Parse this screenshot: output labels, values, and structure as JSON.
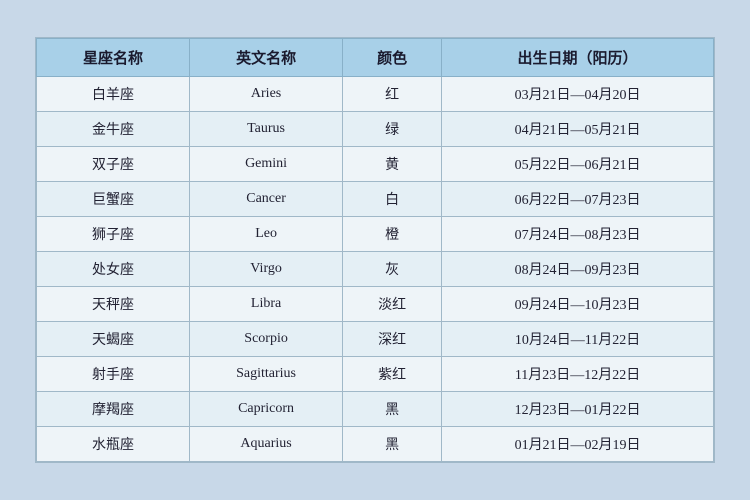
{
  "table": {
    "headers": [
      "星座名称",
      "英文名称",
      "颜色",
      "出生日期（阳历）"
    ],
    "rows": [
      [
        "白羊座",
        "Aries",
        "红",
        "03月21日—04月20日"
      ],
      [
        "金牛座",
        "Taurus",
        "绿",
        "04月21日—05月21日"
      ],
      [
        "双子座",
        "Gemini",
        "黄",
        "05月22日—06月21日"
      ],
      [
        "巨蟹座",
        "Cancer",
        "白",
        "06月22日—07月23日"
      ],
      [
        "狮子座",
        "Leo",
        "橙",
        "07月24日—08月23日"
      ],
      [
        "处女座",
        "Virgo",
        "灰",
        "08月24日—09月23日"
      ],
      [
        "天秤座",
        "Libra",
        "淡红",
        "09月24日—10月23日"
      ],
      [
        "天蝎座",
        "Scorpio",
        "深红",
        "10月24日—11月22日"
      ],
      [
        "射手座",
        "Sagittarius",
        "紫红",
        "11月23日—12月22日"
      ],
      [
        "摩羯座",
        "Capricorn",
        "黑",
        "12月23日—01月22日"
      ],
      [
        "水瓶座",
        "Aquarius",
        "黑",
        "01月21日—02月19日"
      ]
    ]
  }
}
